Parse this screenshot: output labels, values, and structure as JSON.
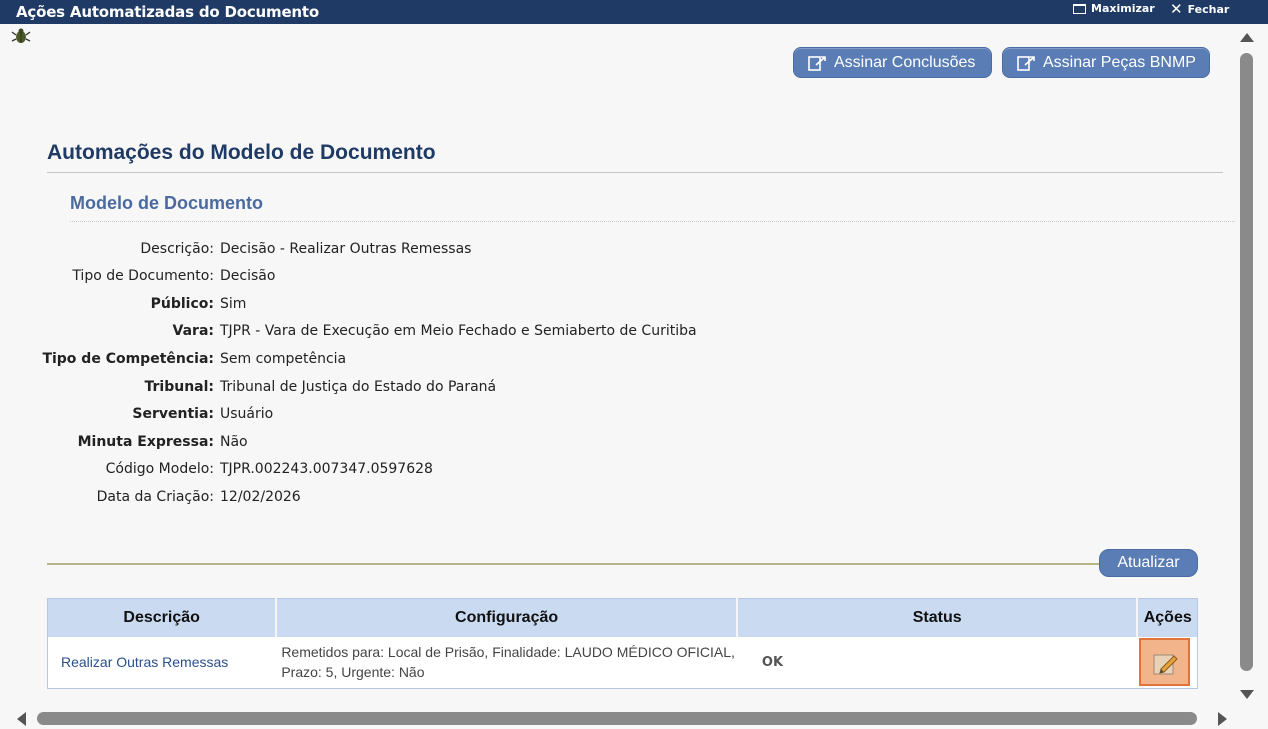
{
  "window": {
    "title": "Ações Automatizadas do Documento",
    "maximize_label": "Maximizar",
    "close_label": "Fechar"
  },
  "toolbar": {
    "sign_conclusions_label": "Assinar Conclusões",
    "sign_bnmp_label": "Assinar Peças BNMP"
  },
  "main": {
    "title": "Automações do Modelo de Documento",
    "section_title": "Modelo de Documento"
  },
  "document": {
    "fields": [
      {
        "label": "Descrição:",
        "value": "Decisão - Realizar Outras Remessas",
        "bold": false
      },
      {
        "label": "Tipo de Documento:",
        "value": "Decisão",
        "bold": false
      },
      {
        "label": "Público:",
        "value": "Sim",
        "bold": true
      },
      {
        "label": "Vara:",
        "value": "TJPR - Vara de Execução em Meio Fechado e Semiaberto de Curitiba",
        "bold": true
      },
      {
        "label": "Tipo de Competência:",
        "value": "Sem competência",
        "bold": true
      },
      {
        "label": "Tribunal:",
        "value": "Tribunal de Justiça do Estado do Paraná",
        "bold": true
      },
      {
        "label": "Serventia:",
        "value": "Usuário",
        "bold": true
      },
      {
        "label": "Minuta Expressa:",
        "value": "Não",
        "bold": true
      },
      {
        "label": "Código Modelo:",
        "value": "TJPR.002243.007347.0597628",
        "bold": false
      },
      {
        "label": "Data da Criação:",
        "value": "12/02/2026",
        "bold": false
      }
    ]
  },
  "actions": {
    "update_label": "Atualizar"
  },
  "table": {
    "headers": [
      "Descrição",
      "Configuração",
      "Status",
      "Ações"
    ],
    "rows": [
      {
        "descricao": "Realizar Outras Remessas",
        "configuracao": "Remetidos para: Local de Prisão, Finalidade: LAUDO MÉDICO OFICIAL, Prazo: 5, Urgente: Não",
        "status": "OK"
      }
    ]
  },
  "colors": {
    "titlebar": "#1f3a64",
    "button": "#5a7db5",
    "heading": "#1f3a64",
    "subheading": "#4a6aa0",
    "table_header": "#c9daf1",
    "edit_button": "#f2b48a"
  },
  "icons": {
    "bug": "bug-icon",
    "maximize": "maximize-icon",
    "close": "close-icon",
    "sign": "sign-document-icon",
    "edit": "pencil-icon"
  }
}
